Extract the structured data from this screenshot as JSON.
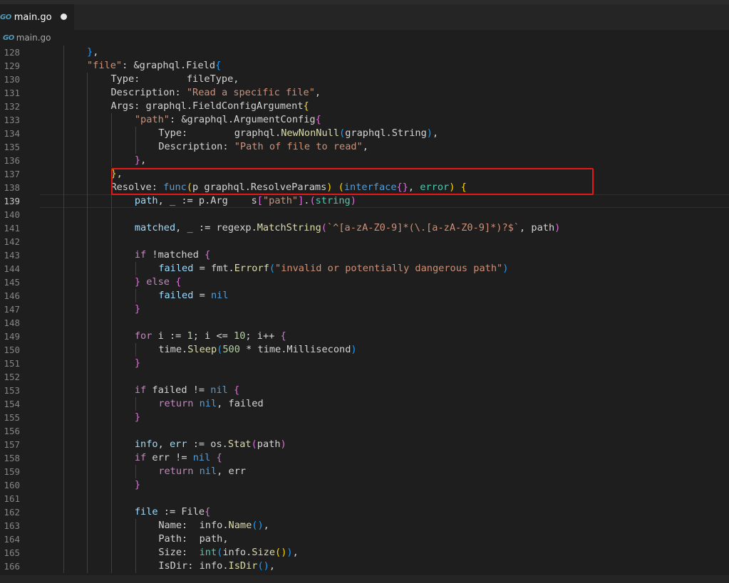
{
  "tab": {
    "filename": "main.go",
    "icon": "go-file-icon",
    "icon_text": "GO",
    "dirty": true
  },
  "breadcrumb": {
    "icon_text": "GO",
    "filename": "main.go"
  },
  "highlight": {
    "line": 141,
    "color": "#e31a1a"
  },
  "editor": {
    "active_line": 139,
    "lines": [
      {
        "n": "128",
        "indent": 2,
        "tokens": [
          [
            "}",
            "br3"
          ],
          [
            ",",
            "plain"
          ]
        ]
      },
      {
        "n": "129",
        "indent": 2,
        "tokens": [
          [
            "\"file\"",
            "str"
          ],
          [
            ": &graphql.Field",
            "plain"
          ],
          [
            "{",
            "br3"
          ]
        ]
      },
      {
        "n": "130",
        "indent": 3,
        "tokens": [
          [
            "Type:        fileType,",
            "plain"
          ]
        ]
      },
      {
        "n": "131",
        "indent": 3,
        "tokens": [
          [
            "Description: ",
            "plain"
          ],
          [
            "\"Read a specific file\"",
            "str"
          ],
          [
            ",",
            "plain"
          ]
        ]
      },
      {
        "n": "132",
        "indent": 3,
        "tokens": [
          [
            "Args: graphql.FieldConfigArgument",
            "plain"
          ],
          [
            "{",
            "br1"
          ]
        ]
      },
      {
        "n": "133",
        "indent": 4,
        "tokens": [
          [
            "\"path\"",
            "str"
          ],
          [
            ": &graphql.ArgumentConfig",
            "plain"
          ],
          [
            "{",
            "br2"
          ]
        ]
      },
      {
        "n": "134",
        "indent": 5,
        "tokens": [
          [
            "Type:        graphql.",
            "plain"
          ],
          [
            "NewNonNull",
            "fn"
          ],
          [
            "(",
            "br3"
          ],
          [
            "graphql.String",
            "plain"
          ],
          [
            ")",
            "br3"
          ],
          [
            ",",
            "plain"
          ]
        ]
      },
      {
        "n": "135",
        "indent": 5,
        "tokens": [
          [
            "Description: ",
            "plain"
          ],
          [
            "\"Path of file to read\"",
            "str"
          ],
          [
            ",",
            "plain"
          ]
        ]
      },
      {
        "n": "136",
        "indent": 4,
        "tokens": [
          [
            "}",
            "br2"
          ],
          [
            ",",
            "plain"
          ]
        ]
      },
      {
        "n": "137",
        "indent": 3,
        "tokens": [
          [
            "}",
            "br1"
          ],
          [
            ",",
            "plain"
          ]
        ]
      },
      {
        "n": "138",
        "indent": 3,
        "tokens": [
          [
            "Resolve: ",
            "plain"
          ],
          [
            "func",
            "blue"
          ],
          [
            "(",
            "br1"
          ],
          [
            "p graphql.ResolveParams",
            "plain"
          ],
          [
            ")",
            "br1"
          ],
          [
            " ",
            "plain"
          ],
          [
            "(",
            "br1"
          ],
          [
            "interface",
            "blue"
          ],
          [
            "{}",
            "br2"
          ],
          [
            ", ",
            "plain"
          ],
          [
            "error",
            "type"
          ],
          [
            ")",
            "br1"
          ],
          [
            " ",
            "plain"
          ],
          [
            "{",
            "br1"
          ]
        ]
      },
      {
        "n": "139",
        "indent": 4,
        "tokens": [
          [
            "path",
            "var"
          ],
          [
            ", _ := p.Arg    s",
            "plain"
          ],
          [
            "[",
            "br2"
          ],
          [
            "\"path\"",
            "str"
          ],
          [
            "]",
            "br2"
          ],
          [
            ".",
            "plain"
          ],
          [
            "(",
            "br2"
          ],
          [
            "string",
            "type"
          ],
          [
            ")",
            "br2"
          ]
        ]
      },
      {
        "n": "140",
        "indent": 4,
        "tokens": []
      },
      {
        "n": "141",
        "indent": 4,
        "tokens": [
          [
            "matched",
            "var"
          ],
          [
            ", _ := regexp.",
            "plain"
          ],
          [
            "MatchString",
            "fn"
          ],
          [
            "(",
            "br2"
          ],
          [
            "`^[a-zA-Z0-9]*(\\.[a-zA-Z0-9]*)?$`",
            "str"
          ],
          [
            ", path",
            "plain"
          ],
          [
            ")",
            "br2"
          ]
        ]
      },
      {
        "n": "142",
        "indent": 4,
        "tokens": []
      },
      {
        "n": "143",
        "indent": 4,
        "tokens": [
          [
            "if",
            "kw"
          ],
          [
            " !matched ",
            "plain"
          ],
          [
            "{",
            "br2"
          ]
        ]
      },
      {
        "n": "144",
        "indent": 5,
        "tokens": [
          [
            "failed",
            "var"
          ],
          [
            " = fmt.",
            "plain"
          ],
          [
            "Errorf",
            "fn"
          ],
          [
            "(",
            "br3"
          ],
          [
            "\"invalid or potentially dangerous path\"",
            "str"
          ],
          [
            ")",
            "br3"
          ]
        ]
      },
      {
        "n": "145",
        "indent": 4,
        "tokens": [
          [
            "}",
            "br2"
          ],
          [
            " ",
            "plain"
          ],
          [
            "else",
            "kw"
          ],
          [
            " ",
            "plain"
          ],
          [
            "{",
            "br2"
          ]
        ]
      },
      {
        "n": "146",
        "indent": 5,
        "tokens": [
          [
            "failed",
            "var"
          ],
          [
            " = ",
            "plain"
          ],
          [
            "nil",
            "blue"
          ]
        ]
      },
      {
        "n": "147",
        "indent": 4,
        "tokens": [
          [
            "}",
            "br2"
          ]
        ]
      },
      {
        "n": "148",
        "indent": 4,
        "tokens": []
      },
      {
        "n": "149",
        "indent": 4,
        "tokens": [
          [
            "for",
            "kw"
          ],
          [
            " i := ",
            "plain"
          ],
          [
            "1",
            "num"
          ],
          [
            "; i <= ",
            "plain"
          ],
          [
            "10",
            "num"
          ],
          [
            "; i++ ",
            "plain"
          ],
          [
            "{",
            "br2"
          ]
        ]
      },
      {
        "n": "150",
        "indent": 5,
        "tokens": [
          [
            "time.",
            "plain"
          ],
          [
            "Sleep",
            "fn"
          ],
          [
            "(",
            "br3"
          ],
          [
            "500",
            "num"
          ],
          [
            " * time.Millisecond",
            "plain"
          ],
          [
            ")",
            "br3"
          ]
        ]
      },
      {
        "n": "151",
        "indent": 4,
        "tokens": [
          [
            "}",
            "br2"
          ]
        ]
      },
      {
        "n": "152",
        "indent": 4,
        "tokens": []
      },
      {
        "n": "153",
        "indent": 4,
        "tokens": [
          [
            "if",
            "kw"
          ],
          [
            " failed != ",
            "plain"
          ],
          [
            "nil",
            "blue"
          ],
          [
            " ",
            "plain"
          ],
          [
            "{",
            "br2"
          ]
        ]
      },
      {
        "n": "154",
        "indent": 5,
        "tokens": [
          [
            "return",
            "kw"
          ],
          [
            " ",
            "plain"
          ],
          [
            "nil",
            "blue"
          ],
          [
            ", failed",
            "plain"
          ]
        ]
      },
      {
        "n": "155",
        "indent": 4,
        "tokens": [
          [
            "}",
            "br2"
          ]
        ]
      },
      {
        "n": "156",
        "indent": 4,
        "tokens": []
      },
      {
        "n": "157",
        "indent": 4,
        "tokens": [
          [
            "info",
            "var"
          ],
          [
            ", ",
            "plain"
          ],
          [
            "err",
            "var"
          ],
          [
            " := os.",
            "plain"
          ],
          [
            "Stat",
            "fn"
          ],
          [
            "(",
            "br2"
          ],
          [
            "path",
            "plain"
          ],
          [
            ")",
            "br2"
          ]
        ]
      },
      {
        "n": "158",
        "indent": 4,
        "tokens": [
          [
            "if",
            "kw"
          ],
          [
            " err != ",
            "plain"
          ],
          [
            "nil",
            "blue"
          ],
          [
            " ",
            "plain"
          ],
          [
            "{",
            "br2"
          ]
        ]
      },
      {
        "n": "159",
        "indent": 5,
        "tokens": [
          [
            "return",
            "kw"
          ],
          [
            " ",
            "plain"
          ],
          [
            "nil",
            "blue"
          ],
          [
            ", err",
            "plain"
          ]
        ]
      },
      {
        "n": "160",
        "indent": 4,
        "tokens": [
          [
            "}",
            "br2"
          ]
        ]
      },
      {
        "n": "161",
        "indent": 4,
        "tokens": []
      },
      {
        "n": "162",
        "indent": 4,
        "tokens": [
          [
            "file",
            "var"
          ],
          [
            " := File",
            "plain"
          ],
          [
            "{",
            "br2"
          ]
        ]
      },
      {
        "n": "163",
        "indent": 5,
        "tokens": [
          [
            "Name:  info.",
            "plain"
          ],
          [
            "Name",
            "fn"
          ],
          [
            "()",
            "br3"
          ],
          [
            ",",
            "plain"
          ]
        ]
      },
      {
        "n": "164",
        "indent": 5,
        "tokens": [
          [
            "Path:  path,",
            "plain"
          ]
        ]
      },
      {
        "n": "165",
        "indent": 5,
        "tokens": [
          [
            "Size:  ",
            "plain"
          ],
          [
            "int",
            "type"
          ],
          [
            "(",
            "br3"
          ],
          [
            "info.",
            "plain"
          ],
          [
            "Size",
            "fn"
          ],
          [
            "()",
            "br1"
          ],
          [
            ")",
            "br3"
          ],
          [
            ",",
            "plain"
          ]
        ]
      },
      {
        "n": "166",
        "indent": 5,
        "tokens": [
          [
            "IsDir: info.",
            "plain"
          ],
          [
            "IsDir",
            "fn"
          ],
          [
            "()",
            "br3"
          ],
          [
            ",",
            "plain"
          ]
        ]
      }
    ]
  }
}
